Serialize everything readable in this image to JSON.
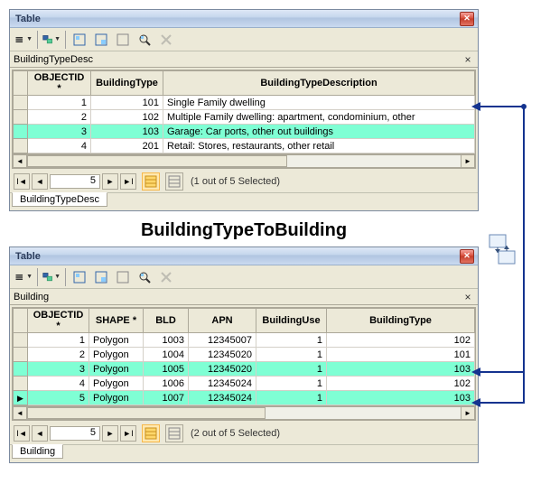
{
  "relationship_label": "BuildingTypeToBuilding",
  "table1": {
    "window_title": "Table",
    "subtitle": "BuildingTypeDesc",
    "columns": [
      "OBJECTID *",
      "BuildingType",
      "BuildingTypeDescription"
    ],
    "rows": [
      {
        "sel": false,
        "mark": "",
        "c0": "1",
        "c1": "101",
        "c2": "Single Family dwelling"
      },
      {
        "sel": false,
        "mark": "",
        "c0": "2",
        "c1": "102",
        "c2": "Multiple Family dwelling: apartment, condominium, other"
      },
      {
        "sel": true,
        "mark": "",
        "c0": "3",
        "c1": "103",
        "c2": "Garage: Car ports, other out buildings"
      },
      {
        "sel": false,
        "mark": "",
        "c0": "4",
        "c1": "201",
        "c2": "Retail: Stores, restaurants, other retail"
      }
    ],
    "nav": {
      "record": "5",
      "status": "(1 out of 5 Selected)"
    },
    "bottom_tab": "BuildingTypeDesc"
  },
  "table2": {
    "window_title": "Table",
    "subtitle": "Building",
    "columns": [
      "OBJECTID *",
      "SHAPE *",
      "BLD",
      "APN",
      "BuildingUse",
      "BuildingType"
    ],
    "rows": [
      {
        "sel": false,
        "mark": "",
        "c0": "1",
        "c1": "Polygon",
        "c2": "1003",
        "c3": "12345007",
        "c4": "1",
        "c5": "102"
      },
      {
        "sel": false,
        "mark": "",
        "c0": "2",
        "c1": "Polygon",
        "c2": "1004",
        "c3": "12345020",
        "c4": "1",
        "c5": "101"
      },
      {
        "sel": true,
        "mark": "",
        "c0": "3",
        "c1": "Polygon",
        "c2": "1005",
        "c3": "12345020",
        "c4": "1",
        "c5": "103"
      },
      {
        "sel": false,
        "mark": "",
        "c0": "4",
        "c1": "Polygon",
        "c2": "1006",
        "c3": "12345024",
        "c4": "1",
        "c5": "102"
      },
      {
        "sel": true,
        "mark": "▶",
        "c0": "5",
        "c1": "Polygon",
        "c2": "1007",
        "c3": "12345024",
        "c4": "1",
        "c5": "103"
      }
    ],
    "nav": {
      "record": "5",
      "status": "(2 out of 5 Selected)"
    },
    "bottom_tab": "Building"
  }
}
